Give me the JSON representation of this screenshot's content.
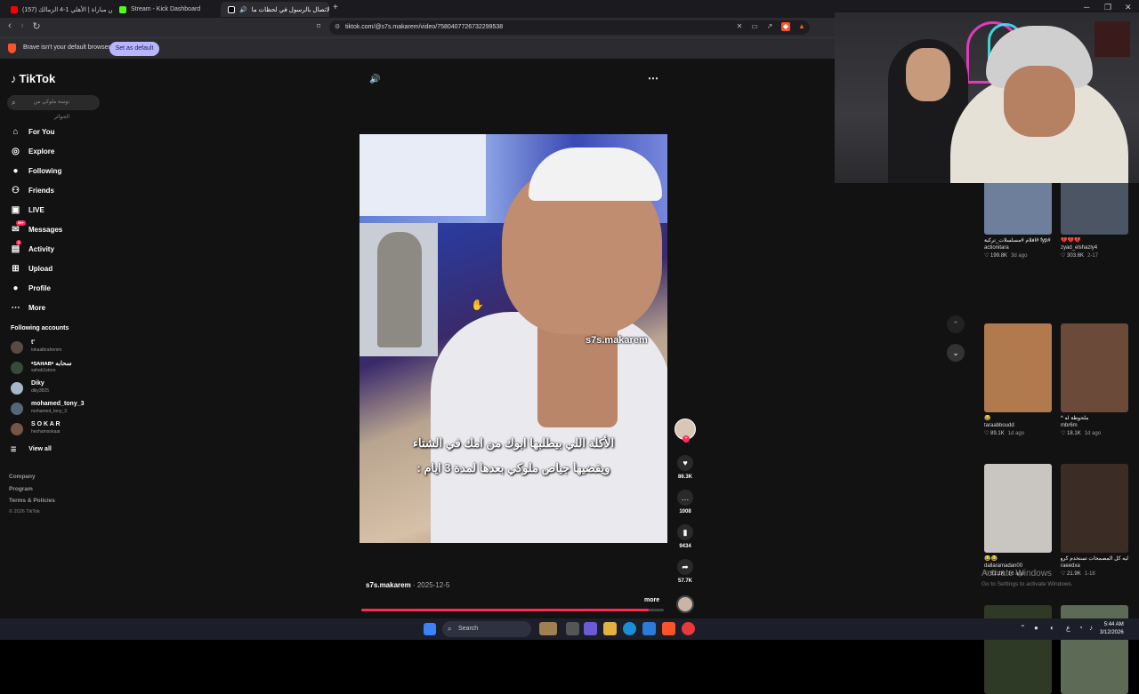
{
  "browser": {
    "tabs": [
      {
        "label": "(157) ملخص مباراة | الأهلي 1-4 الزمالك",
        "icon": "youtube-icon",
        "color": "#ff0000",
        "active": false
      },
      {
        "label": "Stream - Kick Dashboard",
        "icon": "kick-icon",
        "color": "#53fc18",
        "active": false
      },
      {
        "label": "الاتصال بالرسول في لحظات ما",
        "icon": "tiktok-icon",
        "color": "#ffffff",
        "active": true
      }
    ],
    "new_tab": "+",
    "url": "tiktok.com/@s7s.makarem/video/7580407726732299538",
    "infobar_message": "Brave isn't your default browser",
    "set_default_label": "Set as default"
  },
  "tiktok": {
    "logo": "TikTok",
    "search_placeholder": "بوسة ملوكي من الجوائر",
    "nav": [
      {
        "label": "For You",
        "icon": "home-icon",
        "glyph": "⌂"
      },
      {
        "label": "Explore",
        "icon": "compass-icon",
        "glyph": "◎"
      },
      {
        "label": "Following",
        "icon": "following-avatar-icon",
        "glyph": "●"
      },
      {
        "label": "Friends",
        "icon": "friends-icon",
        "glyph": "⚇"
      },
      {
        "label": "LIVE",
        "icon": "live-icon",
        "glyph": "▣"
      },
      {
        "label": "Messages",
        "icon": "messages-icon",
        "glyph": "✉",
        "badge": "99+"
      },
      {
        "label": "Activity",
        "icon": "activity-icon",
        "glyph": "▤",
        "badge": "2"
      },
      {
        "label": "Upload",
        "icon": "upload-icon",
        "glyph": "⊞"
      },
      {
        "label": "Profile",
        "icon": "profile-avatar-icon",
        "glyph": "●"
      },
      {
        "label": "More",
        "icon": "more-icon",
        "glyph": "⋯"
      }
    ],
    "following_heading": "Following accounts",
    "following": [
      {
        "name": "t'",
        "handle": "tokaalbrahemm",
        "color": "#5a4a44"
      },
      {
        "name": "•ꜱᴀʜᴀʙ• سحابه",
        "handle": "sahab1store",
        "color": "#3a4a3a"
      },
      {
        "name": "Diky",
        "handle": "diky3825",
        "color": "#a7b7c9"
      },
      {
        "name": "mohamed_tony_3",
        "handle": "mohamed_tony_3",
        "color": "#556677"
      },
      {
        "name": "S O K A R",
        "handle": "heshamsokaar",
        "color": "#775544"
      }
    ],
    "view_all": "View all",
    "footer_links": [
      "Company",
      "Program",
      "Terms & Policies"
    ],
    "copyright": "© 2026 TikTok",
    "video": {
      "watermark": "s7s.makarem",
      "caption_line1": "الأكلة اللي بيطلبها ابوك من امك في الشتاء",
      "caption_line2": "ويقضيها جياص ملوكي بعدها لمدة 3 ايام :",
      "author": "s7s.makarem",
      "date": "2025-12-5",
      "more": "more",
      "progress": 0.95,
      "likes": "86.3K",
      "comments": "1008",
      "saves": "9434",
      "shares": "57.7K"
    },
    "grid": [
      {
        "title": "#fyp #اقلام #مسلسلات_تركية",
        "user": "actionitara",
        "likes": "199.8K",
        "ago": "3d ago",
        "bg": "#6d7f9a"
      },
      {
        "title": "💔💔💔",
        "user": "zyad_elshazly4",
        "likes": "303.6K",
        "ago": "2-17",
        "bg": "#4b5563"
      },
      {
        "title": "😂",
        "user": "taraabboudd",
        "likes": "89.1K",
        "ago": "1d ago",
        "bg": "#b07a4e"
      },
      {
        "title": "ملحوظة له ^",
        "user": "mbr6m",
        "likes": "18.1K",
        "ago": "1d ago",
        "bg": "#6b4a3a"
      },
      {
        "title": "😂😂",
        "user": "dallaramadan00",
        "likes": "61.1K",
        "ago": "1d ago",
        "bg": "#c9c6c2"
      },
      {
        "title": "ليه كل المصمحات تستخدم كرومبيم ؟",
        "user": "raeedxa",
        "likes": "21.9K",
        "ago": "1-18",
        "bg": "#3b2d26"
      },
      {
        "title": "",
        "user": "",
        "likes": "",
        "ago": "",
        "bg": "#2f3a26"
      },
      {
        "title": "",
        "user": "",
        "likes": "",
        "ago": "",
        "bg": "#5d6a55"
      }
    ],
    "windows_watermark_1": "Activate Windows",
    "windows_watermark_2": "Go to Settings to activate Windows."
  },
  "taskbar": {
    "search": "Search",
    "time": "5:44 AM",
    "date": "3/12/2026",
    "lang": "ع"
  }
}
